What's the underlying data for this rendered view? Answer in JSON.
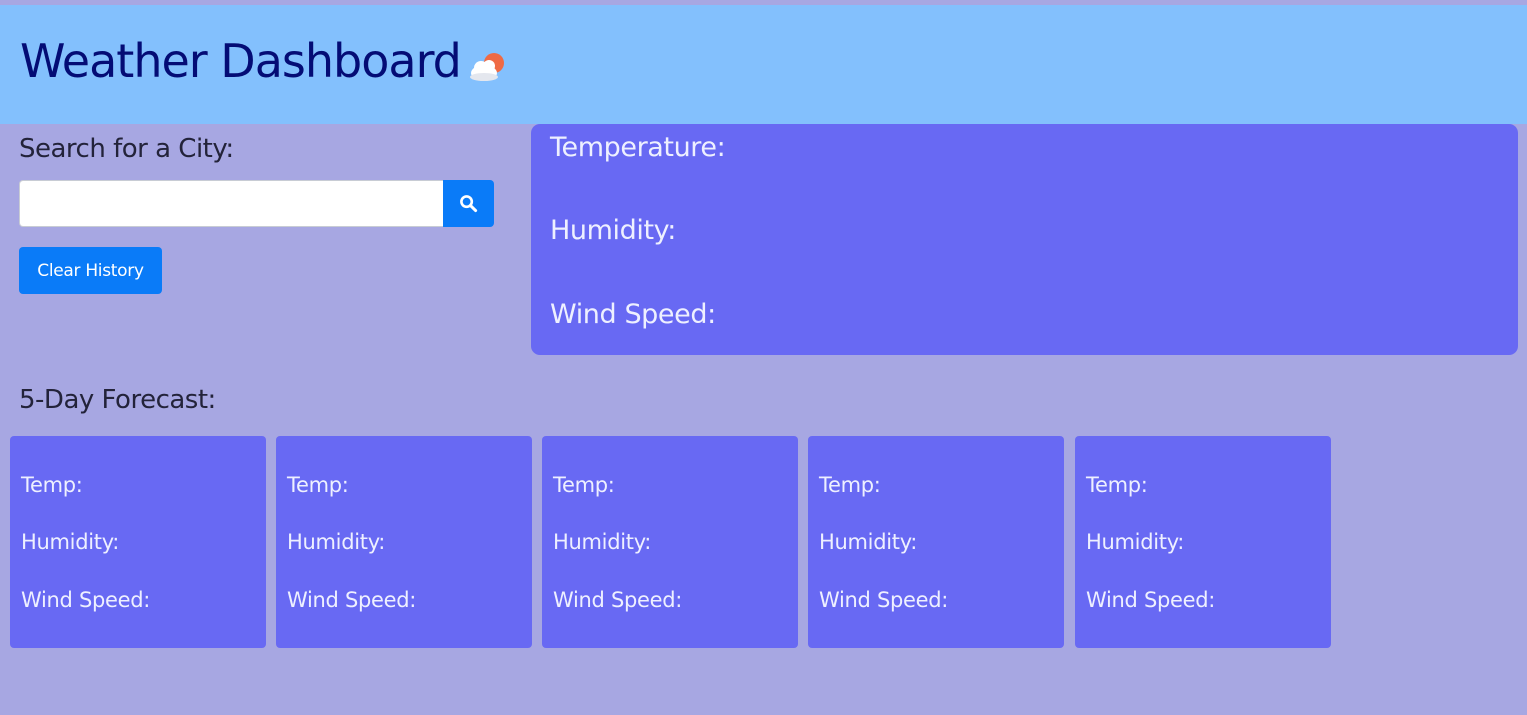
{
  "header": {
    "title": "Weather Dashboard",
    "icon": "partly-cloudy-icon"
  },
  "search": {
    "label": "Search for a City:",
    "value": "",
    "placeholder": "",
    "button_icon": "search-icon"
  },
  "clear_history": {
    "label": "Clear History"
  },
  "current": {
    "temperature_label": "Temperature:",
    "humidity_label": "Humidity:",
    "wind_label": "Wind Speed:"
  },
  "forecast": {
    "title": "5-Day Forecast:",
    "days": [
      {
        "temp": "Temp:",
        "humidity": "Humidity:",
        "wind": "Wind Speed:"
      },
      {
        "temp": "Temp:",
        "humidity": "Humidity:",
        "wind": "Wind Speed:"
      },
      {
        "temp": "Temp:",
        "humidity": "Humidity:",
        "wind": "Wind Speed:"
      },
      {
        "temp": "Temp:",
        "humidity": "Humidity:",
        "wind": "Wind Speed:"
      },
      {
        "temp": "Temp:",
        "humidity": "Humidity:",
        "wind": "Wind Speed:"
      }
    ]
  },
  "colors": {
    "page_background": "#a7a7e2",
    "header_background": "#83c0fd",
    "title_text": "#040c75",
    "panel_background": "#6869f3",
    "button_blue": "#0a7bf8"
  }
}
